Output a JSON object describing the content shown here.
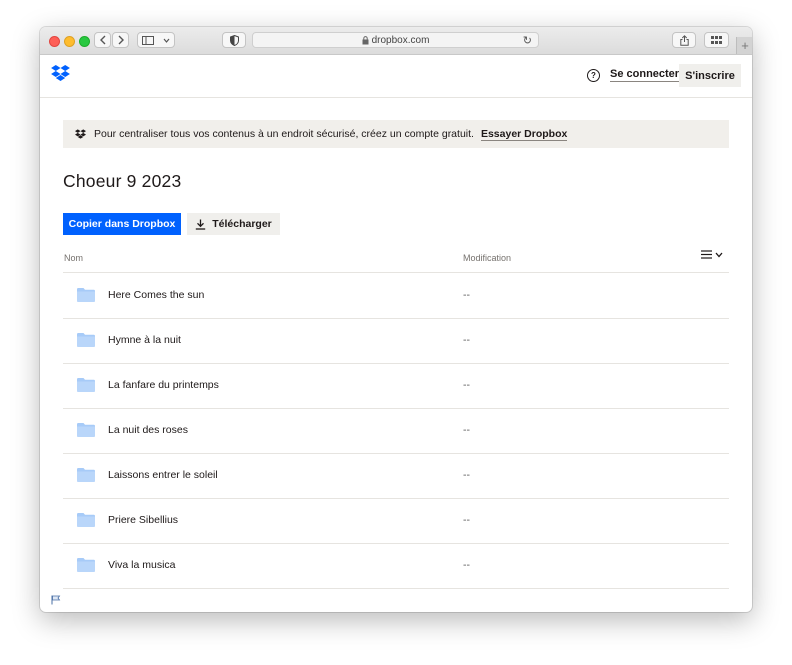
{
  "browser": {
    "url": "dropbox.com"
  },
  "header": {
    "login_label": "Se connecter",
    "signup_label": "S'inscrire"
  },
  "banner": {
    "text": "Pour centraliser tous vos contenus à un endroit sécurisé, créez un compte gratuit.",
    "cta": "Essayer Dropbox"
  },
  "page": {
    "title": "Choeur 9 2023"
  },
  "actions": {
    "copy_label": "Copier dans Dropbox",
    "download_label": "Télécharger"
  },
  "table": {
    "columns": [
      "Nom",
      "Modification"
    ],
    "rows": [
      {
        "name": "Here Comes the sun",
        "modified": "--"
      },
      {
        "name": "Hymne à la nuit",
        "modified": "--"
      },
      {
        "name": "La fanfare du printemps",
        "modified": "--"
      },
      {
        "name": "La nuit des roses",
        "modified": "--"
      },
      {
        "name": "Laissons entrer le soleil",
        "modified": "--"
      },
      {
        "name": "Priere Sibellius",
        "modified": "--"
      },
      {
        "name": "Viva la musica",
        "modified": "--"
      }
    ]
  },
  "colors": {
    "accent": "#0061fe",
    "folder": "#a7cbf8",
    "banner_bg": "#f1efeb"
  }
}
